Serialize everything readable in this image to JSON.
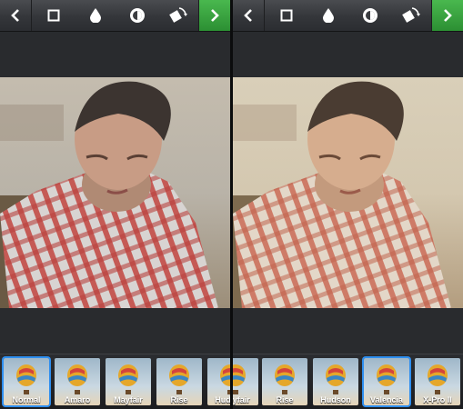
{
  "left_panel": {
    "toolbar": {
      "back": "chevron-left-icon",
      "tools": [
        "square-frame-icon",
        "drop-icon",
        "lux-icon",
        "rotate-icon"
      ],
      "next": "chevron-right-icon"
    },
    "filters": [
      {
        "label": "Normal",
        "selected": true
      },
      {
        "label": "Amaro",
        "selected": false
      },
      {
        "label": "Mayfair",
        "selected": false
      },
      {
        "label": "Rise",
        "selected": false
      },
      {
        "label": "Hudson",
        "selected": false
      }
    ]
  },
  "right_panel": {
    "toolbar": {
      "back": "chevron-left-icon",
      "tools": [
        "square-frame-icon",
        "drop-icon",
        "lux-icon",
        "rotate-icon"
      ],
      "next": "chevron-right-icon"
    },
    "filters": [
      {
        "label": "Mayfair",
        "selected": false
      },
      {
        "label": "Rise",
        "selected": false
      },
      {
        "label": "Hudson",
        "selected": false
      },
      {
        "label": "Valencia",
        "selected": true
      },
      {
        "label": "X-Pro II",
        "selected": false
      }
    ]
  },
  "colors": {
    "accent_green": "#2c8f33",
    "selection_blue": "#2d8ef0"
  }
}
